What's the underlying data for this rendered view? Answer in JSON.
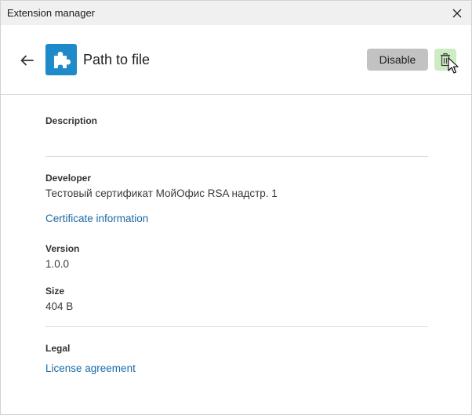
{
  "window": {
    "title": "Extension manager",
    "close_icon": "close-icon"
  },
  "header": {
    "back_icon": "arrow-left-icon",
    "extension_icon": "puzzle-piece-icon",
    "extension_name": "Path to file",
    "disable_label": "Disable",
    "delete_icon": "trash-icon"
  },
  "details": {
    "description_label": "Description",
    "description_value": "",
    "developer_label": "Developer",
    "developer_value": "Тестовый сертификат МойОфис RSA надстр. 1",
    "certificate_link": "Certificate information",
    "version_label": "Version",
    "version_value": "1.0.0",
    "size_label": "Size",
    "size_value": "404 B",
    "legal_label": "Legal",
    "license_link": "License agreement"
  },
  "colors": {
    "accent_icon": "#1f8ac9",
    "link": "#1a6aa6",
    "disable_button": "#c2c2c2",
    "delete_button_hover": "#cdebc4"
  }
}
